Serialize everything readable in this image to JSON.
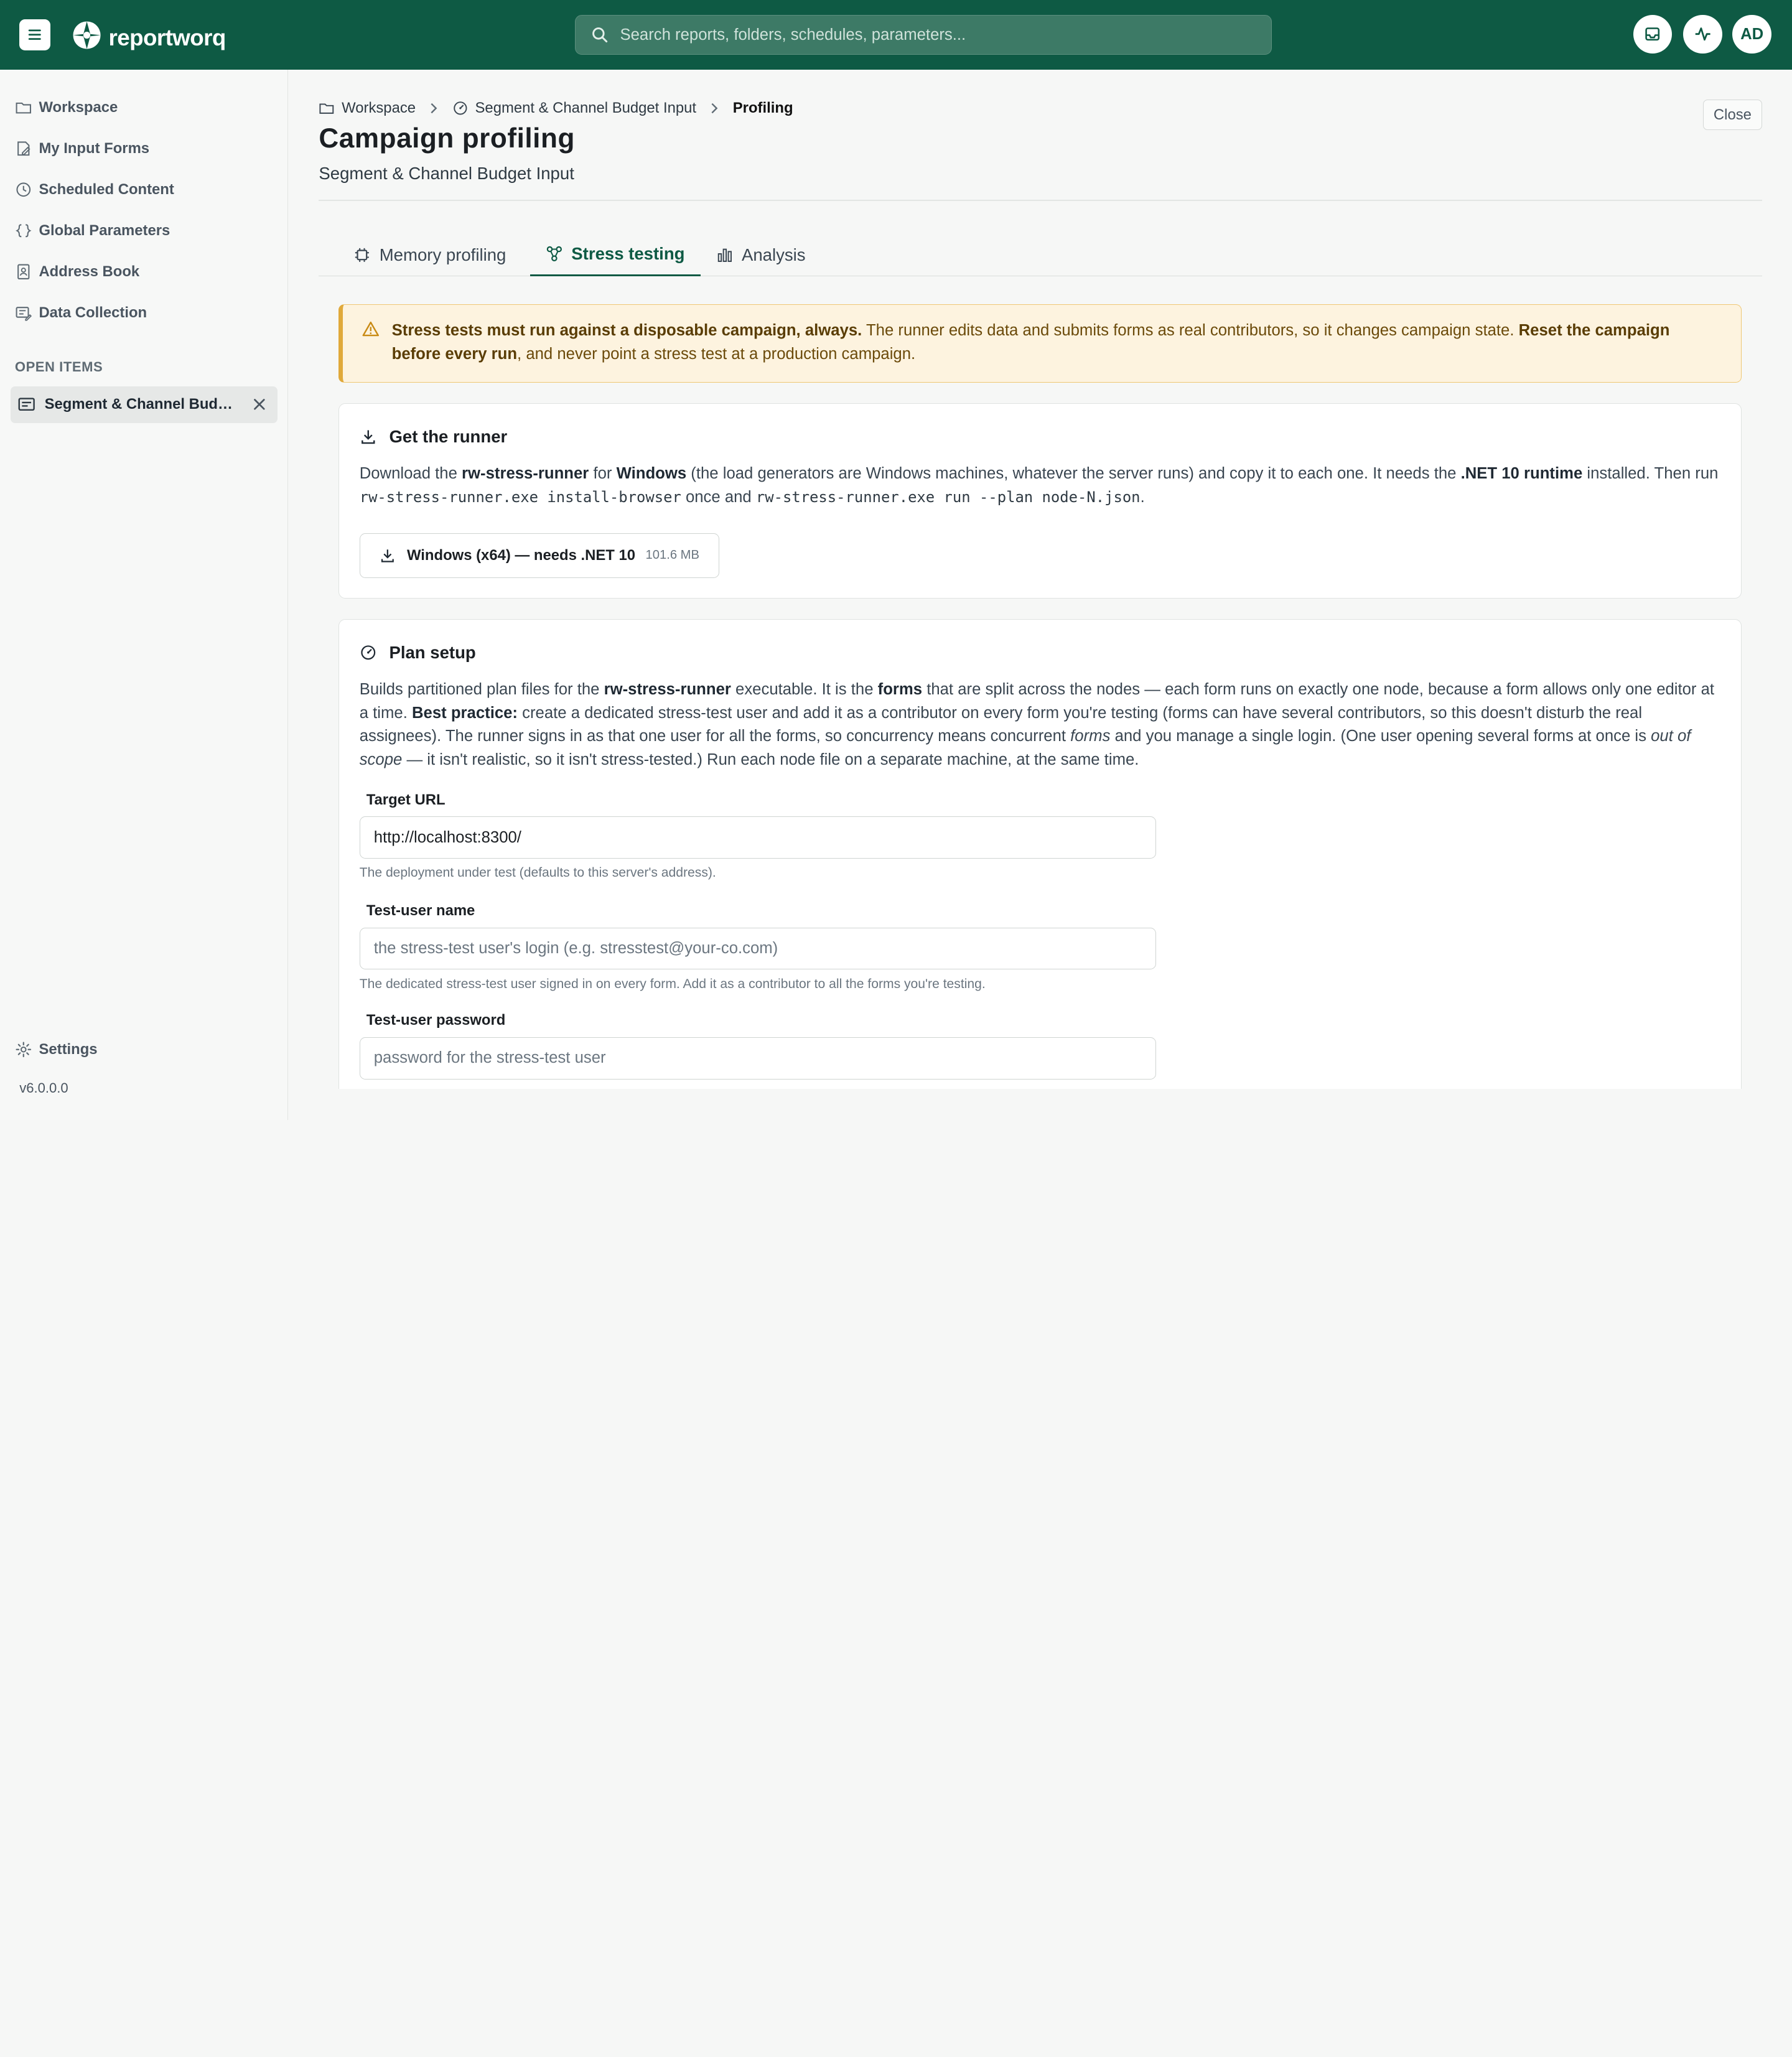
{
  "app": {
    "logo_text": "reportworq",
    "brand_color": "#0e5a44"
  },
  "search": {
    "placeholder": "Search reports, folders, schedules, parameters..."
  },
  "header": {
    "avatar_initials": "AD"
  },
  "sidebar": {
    "items": [
      {
        "label": "Workspace",
        "icon": "folder-icon"
      },
      {
        "label": "My Input Forms",
        "icon": "edit-form-icon"
      },
      {
        "label": "Scheduled Content",
        "icon": "clock-icon"
      },
      {
        "label": "Global Parameters",
        "icon": "braces-icon"
      },
      {
        "label": "Address Book",
        "icon": "contact-book-icon"
      },
      {
        "label": "Data Collection",
        "icon": "data-collection-icon"
      }
    ],
    "open_items_label": "OPEN ITEMS",
    "open_item": "Segment & Channel Budget Input",
    "settings_label": "Settings",
    "version": "v6.0.0.0"
  },
  "breadcrumb": {
    "root": "Workspace",
    "parent": "Segment & Channel Budget Input",
    "current": "Profiling"
  },
  "page": {
    "title": "Campaign profiling",
    "subtitle": "Segment & Channel Budget Input",
    "close_label": "Close"
  },
  "tabs": [
    {
      "label": "Memory profiling",
      "icon": "chip-icon",
      "active": false
    },
    {
      "label": "Stress testing",
      "icon": "nodes-icon",
      "active": true
    },
    {
      "label": "Analysis",
      "icon": "bar-chart-icon",
      "active": false
    }
  ],
  "warning": {
    "bold1": "Stress tests must run against a disposable campaign, always.",
    "text1": " The runner edits data and submits forms as real contributors, so it changes campaign state. ",
    "bold2": "Reset the campaign before every run",
    "text2": ", and never point a stress test at a production campaign."
  },
  "runner": {
    "title": "Get the runner",
    "p1": "Download the ",
    "b1": "rw-stress-runner",
    "p2": " for ",
    "b2": "Windows",
    "p3": " (the load generators are Windows machines, whatever the server runs) and copy it to each one. It needs the ",
    "b3": ".NET 10 runtime",
    "p4": " installed. Then run",
    "code1": "rw-stress-runner.exe install-browser",
    "p5": " once and ",
    "code2": "rw-stress-runner.exe run --plan node-N.json",
    "p6": ".",
    "download_label": "Windows (x64) — needs .NET 10",
    "download_size": "101.6 MB"
  },
  "plan": {
    "title": "Plan setup",
    "t1": "Builds partitioned plan files for the ",
    "b1": "rw-stress-runner",
    "t2": " executable. It is the ",
    "b2": "forms",
    "t3": " that are split across the nodes — each form runs on exactly one node, because a form allows only one editor at a time. ",
    "b3": "Best practice:",
    "t4": " create a dedicated stress-test user and add it as a contributor on every form you're testing (forms can have several contributors, so this doesn't disturb the real assignees). The runner signs in as that one user for all the forms, so concurrency means concurrent ",
    "i1": "forms",
    "t5": " and you manage a single login. (One user opening several forms at once is ",
    "i2": "out of scope",
    "t6": " — it isn't realistic, so it isn't stress-tested.) Run each node file on a separate machine, at the same time.",
    "fields": [
      {
        "label": "Target URL",
        "value": "http://localhost:8300/",
        "placeholder": "",
        "help": "The deployment under test (defaults to this server's address)."
      },
      {
        "label": "Test-user name",
        "value": "",
        "placeholder": "the stress-test user's login (e.g. stresstest@your-co.com)",
        "help": "The dedicated stress-test user signed in on every form. Add it as a contributor to all the forms you're testing."
      },
      {
        "label": "Test-user password",
        "value": "",
        "placeholder": "password for the stress-test user",
        "help": ""
      }
    ]
  }
}
